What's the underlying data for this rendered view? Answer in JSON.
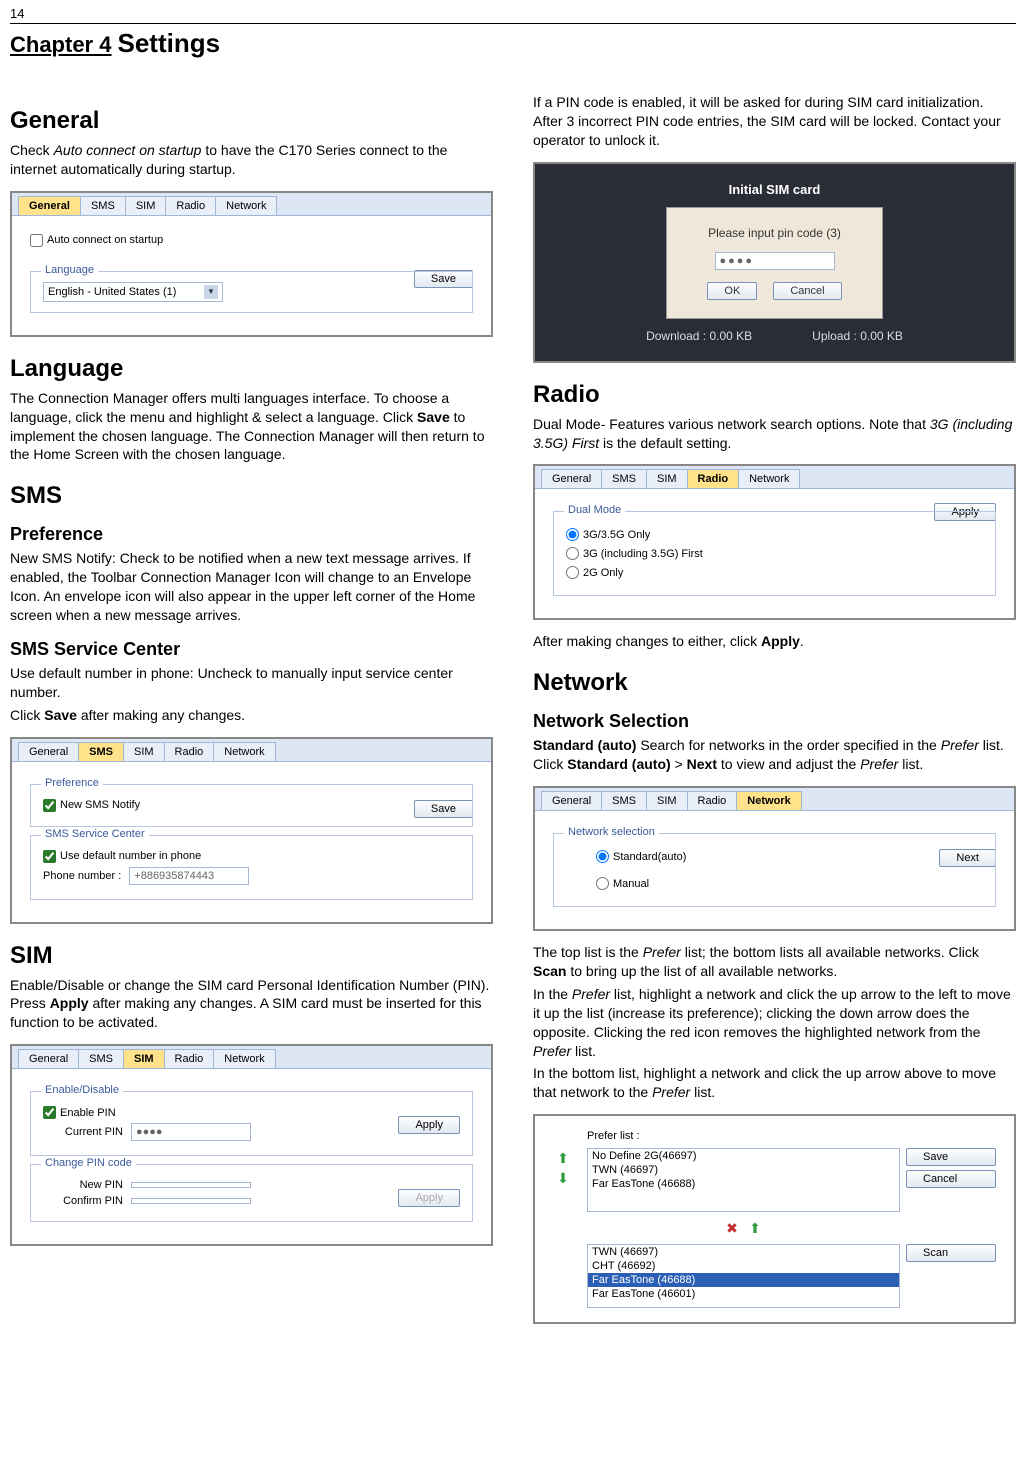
{
  "page_number": "14",
  "chapter_label": "Chapter 4",
  "chapter_title": "Settings",
  "col1": {
    "general": {
      "heading": "General",
      "para1_a": "Check ",
      "para1_b_italic": "Auto connect on startup",
      "para1_c": " to have the C170 Series connect to the internet automatically during startup."
    },
    "fig_general": {
      "tabs": [
        "General",
        "SMS",
        "SIM",
        "Radio",
        "Network"
      ],
      "active_tab": "General",
      "checkbox_label": "Auto connect on startup",
      "group_title": "Language",
      "select_value": "English - United States (1)",
      "save_btn": "Save"
    },
    "language": {
      "heading": "Language",
      "para_a": "The Connection Manager offers multi languages interface. To choose a language, click the menu and highlight & select a language. Click ",
      "para_b_bold": "Save",
      "para_c": " to implement the chosen language. The Connection Manager will then return to the Home Screen with the chosen language."
    },
    "sms": {
      "heading": "SMS",
      "pref_heading": "Preference",
      "pref_para": "New SMS Notify: Check to be notified when a new text message arrives. If enabled, the Toolbar Connection Manager Icon will change to an Envelope Icon. An envelope icon will also appear in the upper left corner of the Home screen when a new message arrives.",
      "center_heading": "SMS Service Center",
      "center_para1": "Use default number in phone: Uncheck to manually input service center number.",
      "center_para2_a": "Click ",
      "center_para2_b_bold": "Save",
      "center_para2_c": " after making any changes."
    },
    "fig_sms": {
      "tabs": [
        "General",
        "SMS",
        "SIM",
        "Radio",
        "Network"
      ],
      "active_tab": "SMS",
      "group1_title": "Preference",
      "chk1_label": "New SMS Notify",
      "group2_title": "SMS Service Center",
      "chk2_label": "Use default number in phone",
      "phone_label": "Phone number :",
      "phone_value": "+886935874443",
      "save_btn": "Save"
    },
    "sim": {
      "heading": "SIM",
      "para_a": "Enable/Disable or change the SIM card Personal Identification Number (PIN). Press ",
      "para_b_bold": "Apply",
      "para_c": " after making any changes. A SIM card must be inserted for this function to be activated."
    },
    "fig_sim": {
      "tabs": [
        "General",
        "SMS",
        "SIM",
        "Radio",
        "Network"
      ],
      "active_tab": "SIM",
      "group1_title": "Enable/Disable",
      "chk_label": "Enable PIN",
      "current_label": "Current PIN",
      "current_value": "●●●●",
      "apply1": "Apply",
      "group2_title": "Change PIN code",
      "new_label": "New PIN",
      "confirm_label": "Confirm PIN",
      "apply2": "Apply"
    }
  },
  "col2": {
    "pin_para": "If a PIN code is enabled, it will be asked for during SIM card initialization. After 3 incorrect PIN code entries, the SIM card will be locked. Contact your operator to unlock it.",
    "fig_pin": {
      "title": "Initial SIM card",
      "prompt": "Please input pin code (3)",
      "value": "●●●●",
      "ok": "OK",
      "cancel": "Cancel",
      "download": "Download : 0.00 KB",
      "upload": "Upload : 0.00 KB"
    },
    "radio": {
      "heading": "Radio",
      "para_a": "Dual Mode- Features various network search options. Note that ",
      "para_b_italic": "3G (including 3.5G) First",
      "para_c": " is the default setting."
    },
    "fig_radio": {
      "tabs": [
        "General",
        "SMS",
        "SIM",
        "Radio",
        "Network"
      ],
      "active_tab": "Radio",
      "group_title": "Dual Mode",
      "r1": "3G/3.5G Only",
      "r2": "3G (including 3.5G) First",
      "r3": "2G Only",
      "apply": "Apply"
    },
    "radio_after_a": "After making changes to either, click ",
    "radio_after_b_bold": "Apply",
    "radio_after_c": ".",
    "network": {
      "heading": "Network",
      "sel_heading": "Network Selection",
      "para_a_bold": "Standard (auto)",
      "para_b": " Search for networks in the order specified in the ",
      "para_c_italic": "Prefer",
      "para_d": " list. Click ",
      "para_e_bold": "Standard (auto)",
      "para_f": " > ",
      "para_g_bold": "Next",
      "para_h": " to view and adjust the ",
      "para_i_italic": "Prefer",
      "para_j": " list."
    },
    "fig_network": {
      "tabs": [
        "General",
        "SMS",
        "SIM",
        "Radio",
        "Network"
      ],
      "active_tab": "Network",
      "group_title": "Network selection",
      "r1": "Standard(auto)",
      "r2": "Manual",
      "next": "Next"
    },
    "prefer_p1_a": "The top list is the ",
    "prefer_p1_b_italic": "Prefer",
    "prefer_p1_c": " list; the bottom lists all available networks. Click ",
    "prefer_p1_d_bold": "Scan",
    "prefer_p1_e": " to bring up the list of all available networks.",
    "prefer_p2_a": "In the ",
    "prefer_p2_b_italic": "Prefer",
    "prefer_p2_c": " list, highlight a network and click the up arrow to the left to move it up the list (increase its preference); clicking the down arrow does the opposite. Clicking the red icon removes the highlighted network from the ",
    "prefer_p2_d_italic": "Prefer",
    "prefer_p2_e": " list.",
    "prefer_p3_a": "In the bottom list, highlight a network and click the up arrow above to move that network to the ",
    "prefer_p3_b_italic": "Prefer",
    "prefer_p3_c": " list.",
    "fig_prefer": {
      "label": "Prefer list :",
      "items_top": [
        "No Define 2G(46697)",
        "TWN (46697)",
        "Far EasTone (46688)"
      ],
      "items_bottom": [
        "TWN (46697)",
        "CHT (46692)",
        "Far EasTone (46688)",
        "Far EasTone (46601)"
      ],
      "sel_bottom": "Far EasTone (46688)",
      "save": "Save",
      "cancel": "Cancel",
      "scan": "Scan"
    }
  }
}
